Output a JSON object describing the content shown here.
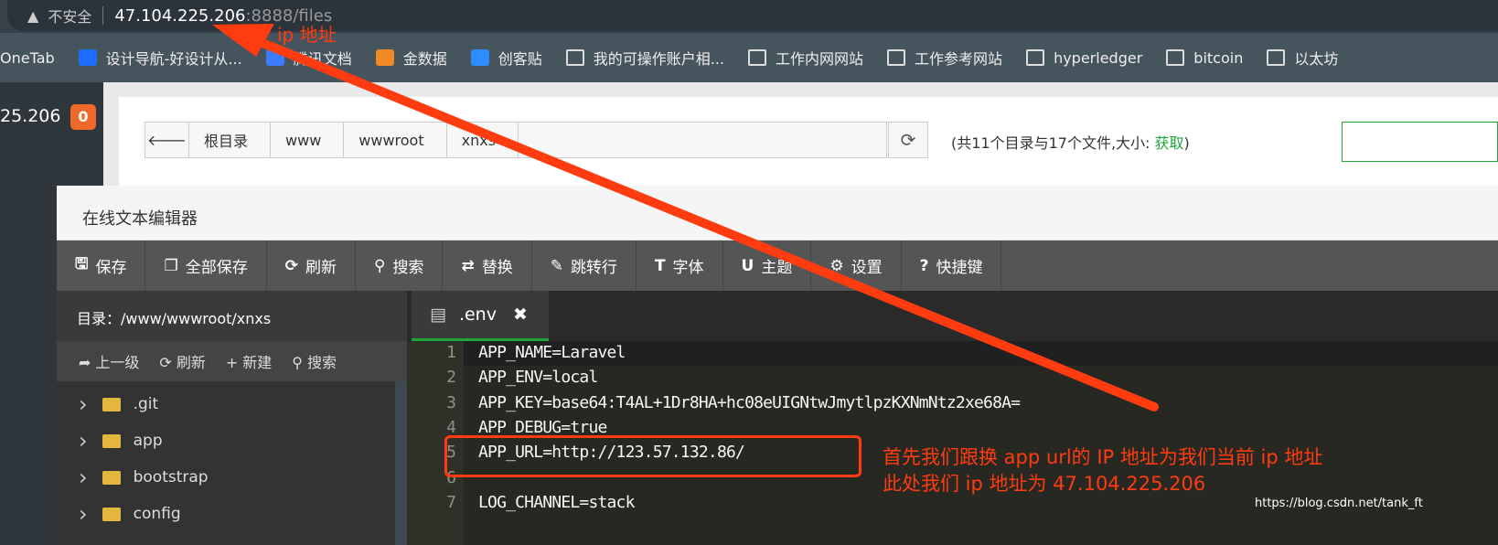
{
  "browser": {
    "security": "不安全",
    "host": "47.104.225.206",
    "path": ":8888/files"
  },
  "bookmarks": [
    {
      "label": "OneTab",
      "icon": "onetab"
    },
    {
      "label": "设计导航-好设计从...",
      "icon": "x-logo",
      "color": "#1e6fff"
    },
    {
      "label": "腾讯文档",
      "icon": "tencent-docs"
    },
    {
      "label": "金数据",
      "icon": "jinshuju",
      "color": "#f08a24"
    },
    {
      "label": "创客贴",
      "icon": "chuangkit",
      "color": "#2f8cff"
    },
    {
      "label": "我的可操作账户相...",
      "icon": "folder"
    },
    {
      "label": "工作内网网站",
      "icon": "folder"
    },
    {
      "label": "工作参考网站",
      "icon": "folder"
    },
    {
      "label": "hyperledger",
      "icon": "folder"
    },
    {
      "label": "bitcoin",
      "icon": "folder"
    },
    {
      "label": "以太坊",
      "icon": "folder"
    }
  ],
  "sidebar": {
    "ip": "25.206",
    "badge": "0"
  },
  "files": {
    "breadcrumb": [
      "根目录",
      "www",
      "wwwroot",
      "xnxs"
    ],
    "info_prefix": "(共11个目录与17个文件,大小: ",
    "info_link": "获取",
    "info_suffix": ")"
  },
  "editor": {
    "title": "在线文本编辑器",
    "toolbar": [
      {
        "icon": "save-icon",
        "glyph": "🖫",
        "label": "保存"
      },
      {
        "icon": "save-all-icon",
        "glyph": "❐",
        "label": "全部保存"
      },
      {
        "icon": "refresh-icon",
        "glyph": "⟳",
        "label": "刷新"
      },
      {
        "icon": "search-icon",
        "glyph": "⚲",
        "label": "搜索"
      },
      {
        "icon": "replace-icon",
        "glyph": "⇄",
        "label": "替换"
      },
      {
        "icon": "pin-icon",
        "glyph": "✎",
        "label": "跳转行"
      },
      {
        "icon": "font-icon",
        "glyph": "T",
        "label": "字体"
      },
      {
        "icon": "theme-icon",
        "glyph": "U",
        "label": "主题"
      },
      {
        "icon": "gear-icon",
        "glyph": "⚙",
        "label": "设置"
      },
      {
        "icon": "help-icon",
        "glyph": "?",
        "label": "快捷键"
      }
    ],
    "tree": {
      "dir": "目录：/www/wwwroot/xnxs",
      "tools": [
        {
          "glyph": "➦",
          "label": "上一级"
        },
        {
          "glyph": "⟳",
          "label": "刷新"
        },
        {
          "glyph": "+",
          "label": "新建"
        },
        {
          "glyph": "⚲",
          "label": "搜索"
        }
      ],
      "items": [
        ".git",
        "app",
        "bootstrap",
        "config"
      ]
    },
    "tab": {
      "name": ".env",
      "close": "✖"
    },
    "lines": [
      {
        "n": "1",
        "text": "APP_NAME=Laravel"
      },
      {
        "n": "2",
        "text": "APP_ENV=local"
      },
      {
        "n": "3",
        "text": "APP_KEY=base64:T4AL+1Dr8HA+hc08eUIGNtwJmytlpzKXNmNtz2xe68A="
      },
      {
        "n": "4",
        "text": "APP_DEBUG=true"
      },
      {
        "n": "5",
        "text": "APP_URL=http://123.57.132.86/"
      },
      {
        "n": "6",
        "text": ""
      },
      {
        "n": "7",
        "text": "LOG_CHANNEL=stack"
      }
    ]
  },
  "annotations": {
    "arrow_label": "ip 地址",
    "note1": "首先我们跟换 app url的 IP 地址为我们当前 ip 地址",
    "note2": "此处我们 ip 地址为 47.104.225.206",
    "color": "#ff3b10"
  },
  "watermark": "https://blog.csdn.net/tank_ft"
}
